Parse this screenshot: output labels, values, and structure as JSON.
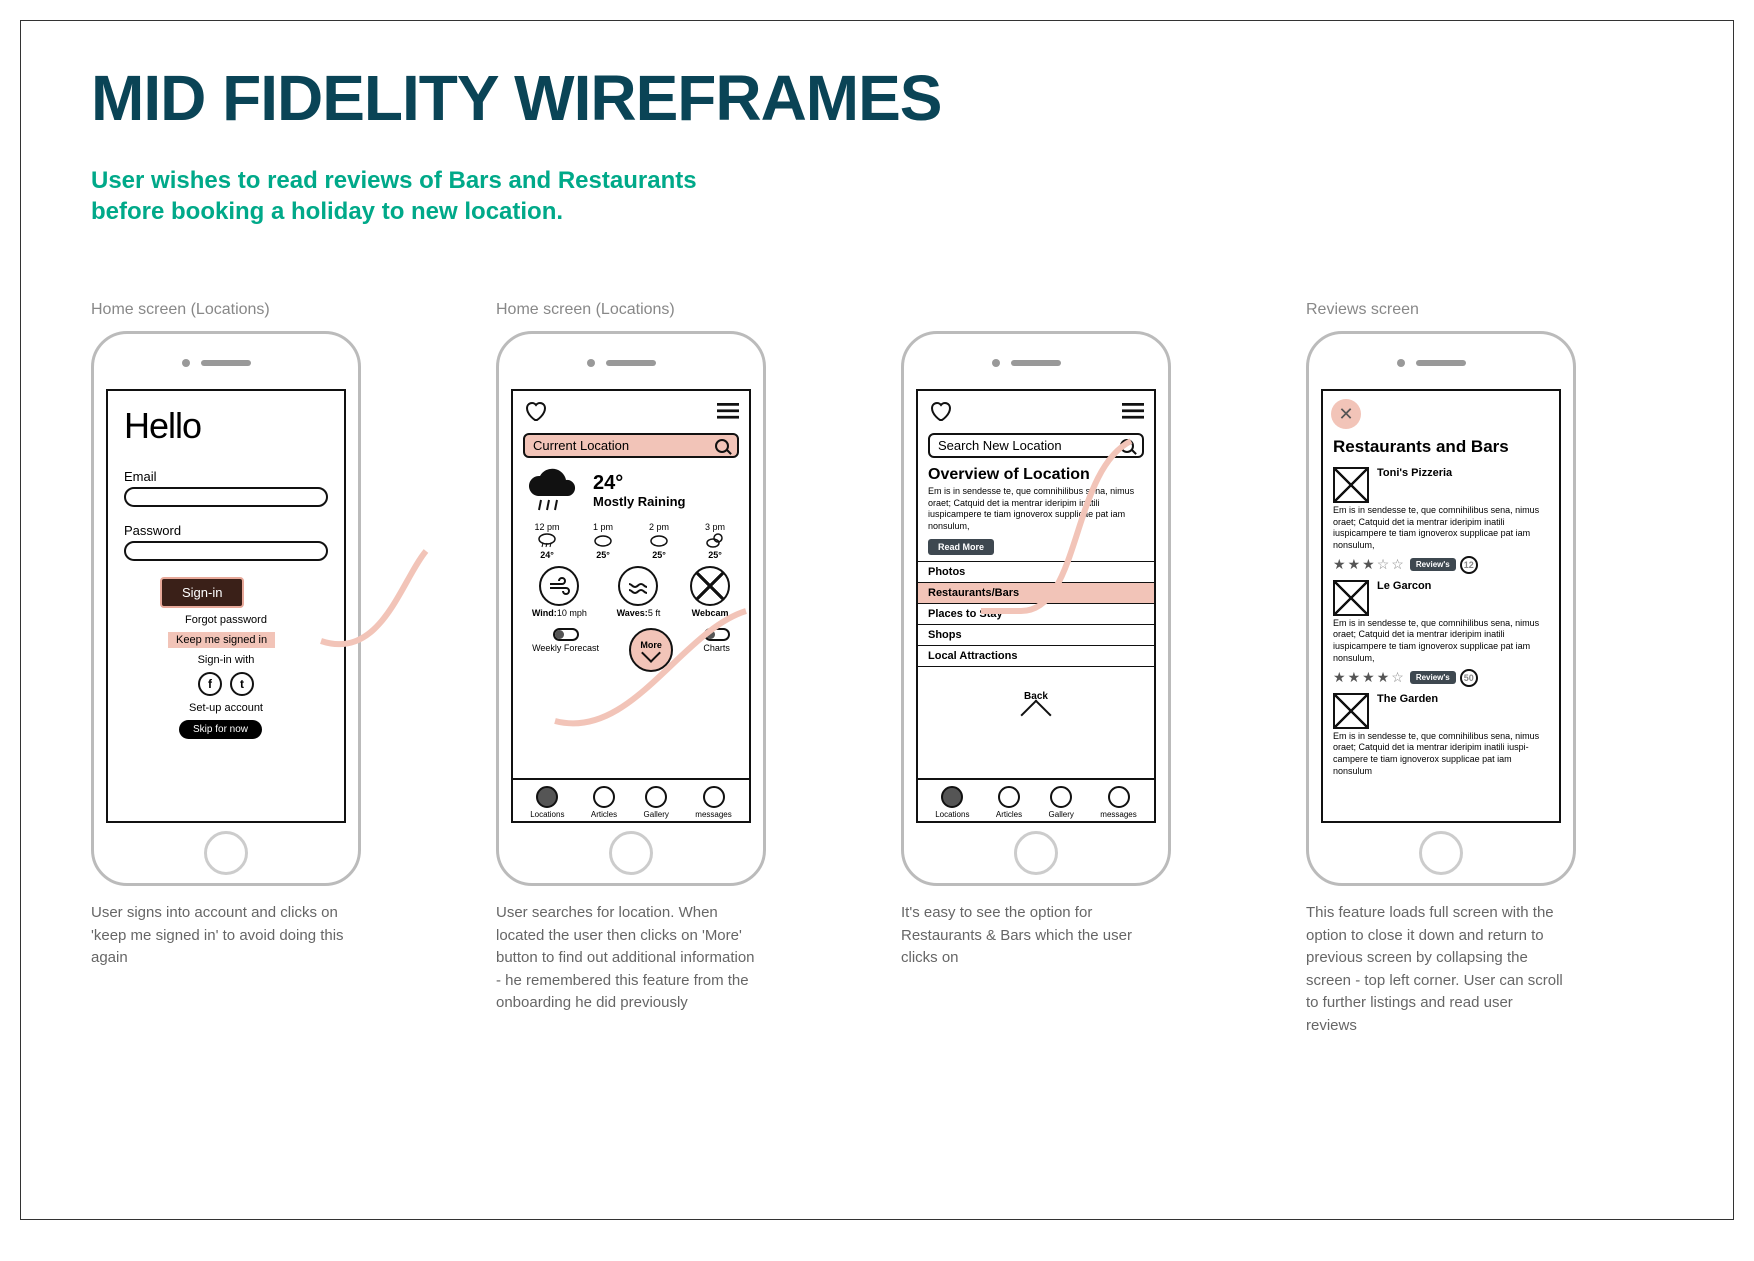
{
  "title": "MID FIDELITY WIREFRAMES",
  "subtitle": "User wishes to read reviews of Bars and Restaurants before booking a holiday to new location.",
  "screens": [
    {
      "label": "Home screen (Locations)",
      "caption": "User signs into account and clicks on 'keep me signed in' to avoid doing this again",
      "hello": "Hello",
      "email_label": "Email",
      "password_label": "Password",
      "signin": "Sign-in",
      "forgot": "Forgot password",
      "keep": "Keep me signed in",
      "signin_with": "Sign-in with",
      "setup": "Set-up account",
      "skip": "Skip for now",
      "social": {
        "facebook": "f",
        "twitter": "t"
      }
    },
    {
      "label": "Home screen (Locations)",
      "caption": "User searches for location. When located the user then clicks on 'More' button to find out additional information - he remembered this feature from the onboarding he did previously",
      "search": "Current Location",
      "temp": "24°",
      "cond": "Mostly Raining",
      "hourly": [
        {
          "t": "12 pm",
          "temp": "24°"
        },
        {
          "t": "1 pm",
          "temp": "25°"
        },
        {
          "t": "2 pm",
          "temp": "25°"
        },
        {
          "t": "3 pm",
          "temp": "25°"
        }
      ],
      "info": [
        {
          "k": "Wind:",
          "v": "10 mph"
        },
        {
          "k": "Waves:",
          "v": "5 ft"
        },
        {
          "k": "Webcam",
          "v": ""
        }
      ],
      "toggles": {
        "weekly": "Weekly Forecast",
        "more": "More",
        "charts": "Charts"
      },
      "tabs": [
        "Locations",
        "Articles",
        "Gallery",
        "messages"
      ]
    },
    {
      "label": "",
      "caption": "It's easy to see the option for Restaurants & Bars which the user clicks on",
      "search": "Search New Location",
      "ov_title": "Overview of Location",
      "ov_text": "Em is in sendesse te, que comnihilibus sena, nimus oraet; Catquid det ia mentrar ideripim inatili iuspicampere te tiam ignoverox supplicae pat iam nonsulum,",
      "read_more": "Read More",
      "items": [
        "Photos",
        "Restaurants/Bars",
        "Places to Stay",
        "Shops",
        "Local Attractions"
      ],
      "back": "Back",
      "tabs": [
        "Locations",
        "Articles",
        "Gallery",
        "messages"
      ]
    },
    {
      "label": "Reviews screen",
      "caption": "This feature loads full screen with the option to close it down and return to previous screen by collapsing the screen - top left corner. User can scroll to further listings and read user reviews",
      "title": "Restaurants and Bars",
      "reviews_label": "Review's",
      "reviews": [
        {
          "name": "Toni's Pizzeria",
          "text": "Em is in sendesse te, que comnihilibus sena, nimus oraet; Catquid det ia mentrar ideripim inatili iuspicampere te tiam ignoverox supplicae pat iam nonsulum,",
          "stars": 3,
          "count": "12"
        },
        {
          "name": "Le Garcon",
          "text": "Em is in sendesse te, que comnihilibus sena, nimus oraet; Catquid det ia mentrar ideripim inatili iuspicampere te tiam ignoverox supplicae pat iam nonsulum,",
          "stars": 4,
          "count": "50"
        },
        {
          "name": "The Garden",
          "text": "Em is in sendesse te, que comnihilibus sena, nimus oraet; Catquid det ia mentrar ideripim inatili iuspi-campere te tiam ignoverox supplicae pat iam nonsulum",
          "stars": 0,
          "count": ""
        }
      ]
    }
  ]
}
